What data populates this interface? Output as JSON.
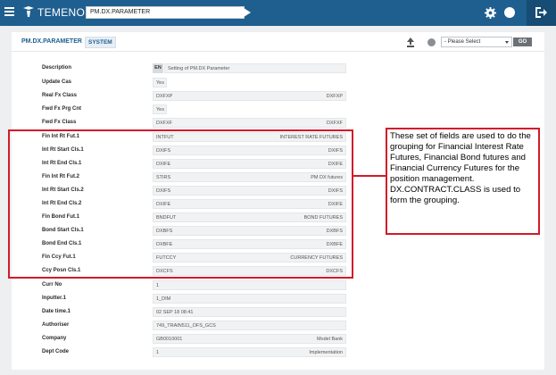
{
  "topbar": {
    "brand": "TEMENOS",
    "command_value": "PM.DX.PARAMETER"
  },
  "panel": {
    "title": "PM.DX.PARAMETER",
    "badge": "SYSTEM",
    "select_placeholder": "- Please Select",
    "go_label": "GO"
  },
  "rows": [
    {
      "label": "Description",
      "lang": "EN",
      "v1": "Setting of PM.DX Parameter",
      "v2": ""
    },
    {
      "label": "Update Cas",
      "v1": "Yes",
      "v2": ""
    },
    {
      "label": "Real Fx Class",
      "v1": "DXFXP",
      "v2": "DXFXP"
    },
    {
      "label": "Fwd Fx Prg Cnt",
      "v1": "Yes",
      "v2": ""
    },
    {
      "label": "Fwd Fx Class",
      "v1": "DXFXF",
      "v2": "DXFXF"
    },
    {
      "label": "Fin Int Rt Fut.1",
      "v1": "INTFUT",
      "v2": "INTEREST RATE FUTURES"
    },
    {
      "label": "Int Rt Start Cls.1",
      "v1": "DXIFS",
      "v2": "DXIFS"
    },
    {
      "label": "Int Rt End Cls.1",
      "v1": "DXIFE",
      "v2": "DXIFE"
    },
    {
      "label": "Fin Int Rt Fut.2",
      "v1": "STIRS",
      "v2": "PM DX futures"
    },
    {
      "label": "Int Rt Start Cls.2",
      "v1": "DXIFS",
      "v2": "DXIFS"
    },
    {
      "label": "Int Rt End Cls.2",
      "v1": "DXIFE",
      "v2": "DXIFE"
    },
    {
      "label": "Fin Bond Fut.1",
      "v1": "BNDFUT",
      "v2": "BOND FUTURES"
    },
    {
      "label": "Bond Start Cls.1",
      "v1": "DXBFS",
      "v2": "DXBFS"
    },
    {
      "label": "Bond End Cls.1",
      "v1": "DXBFE",
      "v2": "DXBFE"
    },
    {
      "label": "Fin Ccy Fut.1",
      "v1": "FUTCCY",
      "v2": "CURRENCY FUTURES"
    },
    {
      "label": "Ccy Posn Cls.1",
      "v1": "DXCFS",
      "v2": "DXCFS"
    },
    {
      "label": "Curr No",
      "v1": "1",
      "v2": ""
    },
    {
      "label": "Inputter.1",
      "v1": "1_DIM",
      "v2": ""
    },
    {
      "label": "Date time.1",
      "v1": "02 SEP 18 08:41",
      "v2": ""
    },
    {
      "label": "Authoriser",
      "v1": "749_TRAIN511_OFS_GCS",
      "v2": ""
    },
    {
      "label": "Company",
      "v1": "GB0010001",
      "v2": "Model Bank"
    },
    {
      "label": "Dept Code",
      "v1": "1",
      "v2": "Implementation"
    }
  ],
  "annotation": {
    "text": "These set of fields are used to do the grouping for Financial Interest Rate Futures, Financial Bond futures and Financial Currency Futures for the position management. DX.CONTRACT.CLASS is used to form the grouping.",
    "border_color": "#d11a2a"
  },
  "colors": {
    "topbar": "#1f5f8f",
    "accent": "#1f5f8f",
    "annotation": "#d11a2a"
  }
}
